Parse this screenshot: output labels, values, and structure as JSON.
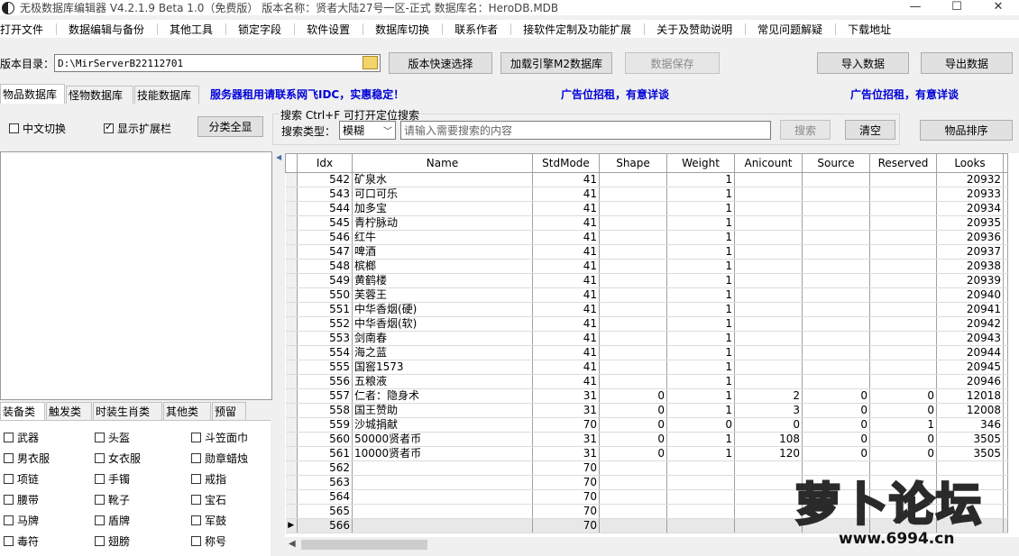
{
  "window": {
    "title": "无极数据库编辑器 V4.2.1.9    Beta 1.0（免费版）    版本名称：贤者大陆27号一区-正式    数据库名：HeroDB.MDB",
    "minimize": "—",
    "maximize": "☐",
    "close": "✕"
  },
  "menu": [
    "打开文件",
    "数据编辑与备份",
    "其他工具",
    "锁定字段",
    "软件设置",
    "数据库切换",
    "联系作者",
    "接软件定制及功能扩展",
    "关于及赞助说明",
    "常见问题解疑",
    "下载地址"
  ],
  "toolbar": {
    "dir_label": "版本目录：",
    "dir_value": "D:\\MirServerB22112701",
    "quick_select": "版本快速选择",
    "load_engine": "加载引擎M2数据库",
    "save_data": "数据保存",
    "import_data": "导入数据",
    "export_data": "导出数据"
  },
  "tabs": [
    "物品数据库",
    "怪物数据库",
    "技能数据库"
  ],
  "ads": {
    "server": "服务器租用请联系网飞IDC，实惠稳定！",
    "ad1": "广告位招租，有意详谈",
    "ad2": "广告位招租，有意详谈"
  },
  "options": {
    "chinese_switch": "中文切换",
    "show_ext": "显示扩展栏",
    "show_all": "分类全显"
  },
  "search": {
    "title": "搜索   Ctrl+F 可打开定位搜索",
    "type_label": "搜索类型：",
    "type_value": "模糊",
    "placeholder": "请输入需要搜索的内容",
    "search_btn": "搜索",
    "clear_btn": "清空",
    "sort_btn": "物品排序"
  },
  "category_tabs": [
    "装备类",
    "触发类",
    "时装生肖类",
    "其他类",
    "预留"
  ],
  "categories": [
    "武器",
    "头盔",
    "斗笠面巾",
    "男衣服",
    "女衣服",
    "勋章蜡烛",
    "项链",
    "手镯",
    "戒指",
    "腰带",
    "靴子",
    "宝石",
    "马牌",
    "盾牌",
    "军鼓",
    "毒符",
    "翅膀",
    "称号"
  ],
  "grid": {
    "columns": [
      "Idx",
      "Name",
      "StdMode",
      "Shape",
      "Weight",
      "Anicount",
      "Source",
      "Reserved",
      "Looks"
    ],
    "rows": [
      [
        "542",
        "矿泉水",
        "41",
        "",
        "1",
        "",
        "",
        "",
        "20932"
      ],
      [
        "543",
        "可口可乐",
        "41",
        "",
        "1",
        "",
        "",
        "",
        "20933"
      ],
      [
        "544",
        "加多宝",
        "41",
        "",
        "1",
        "",
        "",
        "",
        "20934"
      ],
      [
        "545",
        "青柠脉动",
        "41",
        "",
        "1",
        "",
        "",
        "",
        "20935"
      ],
      [
        "546",
        "红牛",
        "41",
        "",
        "1",
        "",
        "",
        "",
        "20936"
      ],
      [
        "547",
        "啤酒",
        "41",
        "",
        "1",
        "",
        "",
        "",
        "20937"
      ],
      [
        "548",
        "槟榔",
        "41",
        "",
        "1",
        "",
        "",
        "",
        "20938"
      ],
      [
        "549",
        "黄鹤楼",
        "41",
        "",
        "1",
        "",
        "",
        "",
        "20939"
      ],
      [
        "550",
        "芙蓉王",
        "41",
        "",
        "1",
        "",
        "",
        "",
        "20940"
      ],
      [
        "551",
        "中华香烟(硬)",
        "41",
        "",
        "1",
        "",
        "",
        "",
        "20941"
      ],
      [
        "552",
        "中华香烟(软)",
        "41",
        "",
        "1",
        "",
        "",
        "",
        "20942"
      ],
      [
        "553",
        "剑南春",
        "41",
        "",
        "1",
        "",
        "",
        "",
        "20943"
      ],
      [
        "554",
        "海之蓝",
        "41",
        "",
        "1",
        "",
        "",
        "",
        "20944"
      ],
      [
        "555",
        "国窖1573",
        "41",
        "",
        "1",
        "",
        "",
        "",
        "20945"
      ],
      [
        "556",
        "五粮液",
        "41",
        "",
        "1",
        "",
        "",
        "",
        "20946"
      ],
      [
        "557",
        "仁者：隐身术",
        "31",
        "0",
        "1",
        "2",
        "0",
        "0",
        "12018"
      ],
      [
        "558",
        "国王赞助",
        "31",
        "0",
        "1",
        "3",
        "0",
        "0",
        "12008"
      ],
      [
        "559",
        "沙城捐献",
        "70",
        "0",
        "0",
        "0",
        "0",
        "1",
        "346"
      ],
      [
        "560",
        "50000贤者币",
        "31",
        "0",
        "1",
        "108",
        "0",
        "0",
        "3505"
      ],
      [
        "561",
        "10000贤者币",
        "31",
        "0",
        "1",
        "120",
        "0",
        "0",
        "3505"
      ],
      [
        "562",
        "",
        "70",
        "",
        "",
        "",
        "",
        "",
        ""
      ],
      [
        "563",
        "",
        "70",
        "",
        "",
        "",
        "",
        "",
        ""
      ],
      [
        "564",
        "",
        "70",
        "",
        "",
        "",
        "",
        "",
        ""
      ],
      [
        "565",
        "",
        "70",
        "",
        "",
        "",
        "",
        "",
        ""
      ],
      [
        "566",
        "",
        "70",
        "",
        "",
        "",
        "",
        "",
        ""
      ]
    ],
    "selected_row": 24,
    "row_pointer": "▶"
  },
  "watermark": {
    "text": "萝卜论坛",
    "url": "www.6994.cn"
  }
}
